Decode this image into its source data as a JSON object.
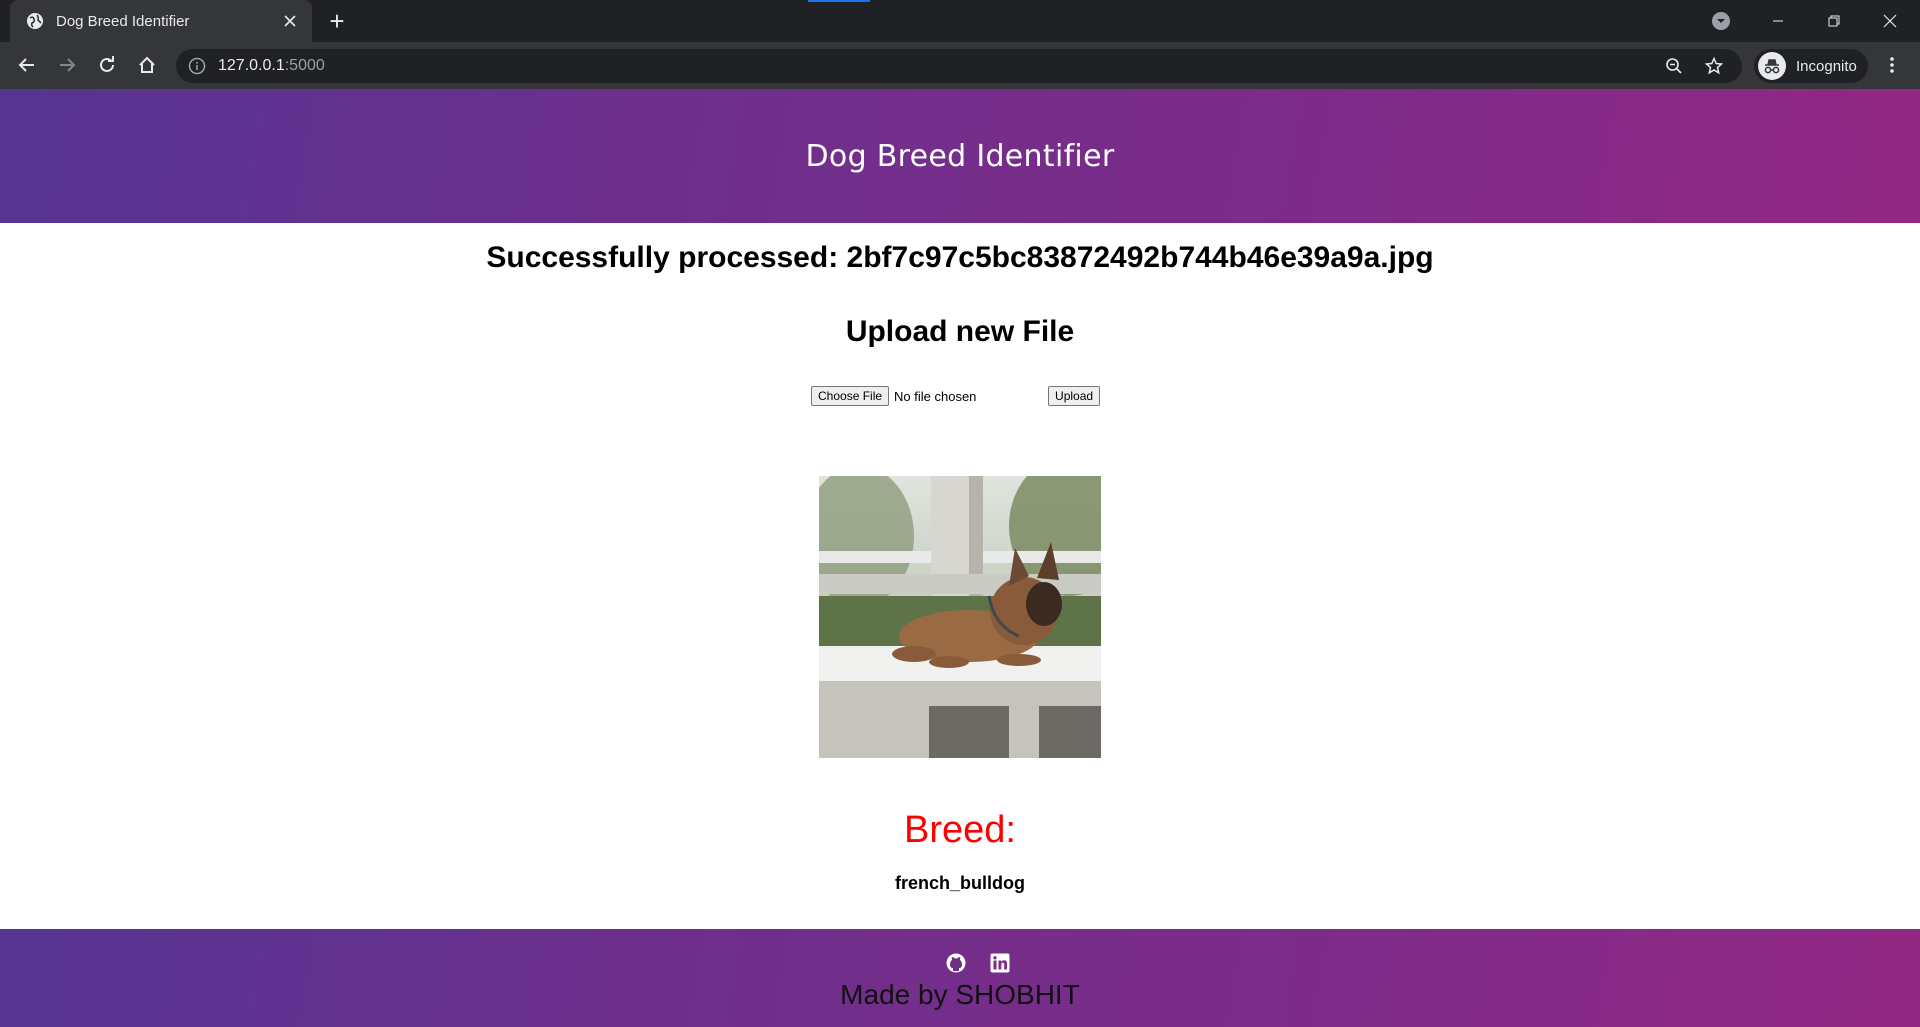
{
  "browser": {
    "tab_title": "Dog Breed Identifier",
    "new_tab_symbol": "+",
    "url_host": "127.0.0.1",
    "url_port": ":5000",
    "profile_label": "Incognito"
  },
  "page": {
    "header_title": "Dog Breed Identifier",
    "processed_message": "Successfully processed: 2bf7c97c5bc83872492b744b46e39a9a.jpg",
    "upload_heading": "Upload new File",
    "choose_file_label": "Choose File",
    "no_file_text": "No file chosen",
    "upload_button_label": "Upload",
    "breed_label": "Breed:",
    "breed_value": "french_bulldog",
    "footer_text": "Made by SHOBHIT"
  },
  "icons": {
    "tab": "globe-icon",
    "footer_left": "github-icon",
    "footer_right": "linkedin-icon"
  },
  "colors": {
    "header_gradient_start": "#553591",
    "header_gradient_end": "#932884",
    "breed_label": "#ff0000"
  }
}
